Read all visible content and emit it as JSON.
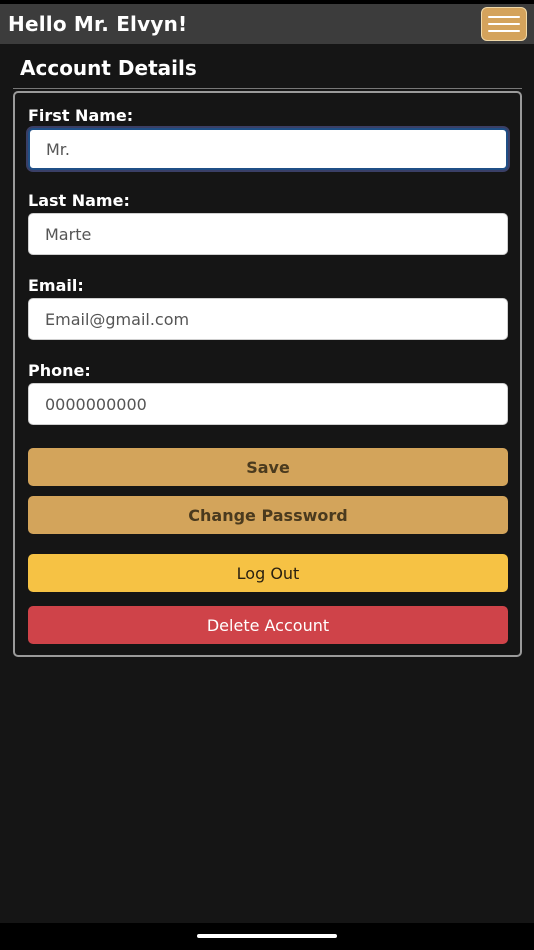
{
  "header": {
    "greeting": "Hello Mr. Elvyn!",
    "menu_icon": "hamburger-menu-icon",
    "accent_color": "#d4a35c"
  },
  "account": {
    "title": "Account Details",
    "fields": {
      "first_name": {
        "label": "First Name:",
        "value": "Mr."
      },
      "last_name": {
        "label": "Last Name:",
        "value": "Marte"
      },
      "email": {
        "label": "Email:",
        "value": "Email@gmail.com"
      },
      "phone": {
        "label": "Phone:",
        "value": "0000000000"
      }
    },
    "buttons": {
      "save": "Save",
      "change_password": "Change Password",
      "log_out": "Log Out",
      "delete_account": "Delete Account"
    }
  },
  "colors": {
    "background": "#151515",
    "header": "#3c3c3c",
    "save": "#d3a45b",
    "log_out": "#f6c244",
    "delete": "#cf4349"
  }
}
